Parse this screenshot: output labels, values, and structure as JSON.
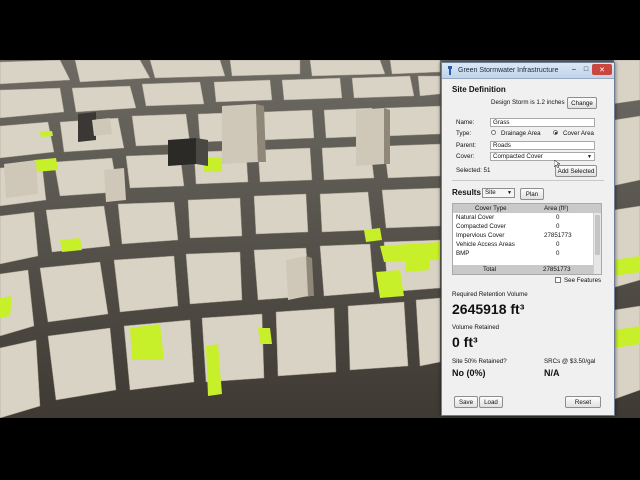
{
  "window": {
    "title": "Green Stormwater Infrastructure",
    "min_label": "–",
    "max_label": "□",
    "close_label": "✕"
  },
  "site_definition": {
    "heading": "Site Definition",
    "design_storm": "Design Storm is 1.2 inches",
    "change_label": "Change",
    "name_label": "Name:",
    "name_value": "Grass",
    "type_label": "Type:",
    "type_option_drainage": "Drainage Area",
    "type_option_cover": "Cover Area",
    "type_selected": "Cover Area",
    "parent_label": "Parent:",
    "parent_value": "Roads",
    "cover_label": "Cover:",
    "cover_value": "Compacted Cover",
    "selected_text": "Selected: 51",
    "add_selected_label": "Add Selected"
  },
  "results": {
    "heading": "Results",
    "scope_value": "Site",
    "plan_label": "Plan",
    "columns": [
      "Cover Type",
      "Area (ft²)"
    ],
    "rows": [
      [
        "Natural Cover",
        "0"
      ],
      [
        "Compacted Cover",
        "0"
      ],
      [
        "Impervious Cover",
        "27851773"
      ],
      [
        "Vehicle Access Areas",
        "0"
      ],
      [
        "BMP",
        "0"
      ]
    ],
    "total_label": "Total",
    "total_value": "27851773",
    "see_features_label": "See Features"
  },
  "required_retention": {
    "label": "Required Retention Volume",
    "value": "2645918 ft³"
  },
  "volume_retained": {
    "label": "Volume Retained",
    "value": "0 ft³"
  },
  "site_50": {
    "label": "Site 50% Retained?",
    "value": "No (0%)"
  },
  "srcs": {
    "label": "SRCs @ $3.50/gal",
    "value": "N/A"
  },
  "buttons": {
    "save": "Save",
    "load": "Load",
    "reset": "Reset"
  },
  "colors": {
    "bmp_highlight": "#c8f02a",
    "building": "#d9d3c6",
    "street": "#4a463e",
    "title_bar": "#c8d9ee",
    "close": "#c9473f"
  },
  "icons": {
    "app": "gsi-app-icon",
    "dropdown": "chevron-down-icon",
    "cursor": "mouse-cursor-icon"
  }
}
